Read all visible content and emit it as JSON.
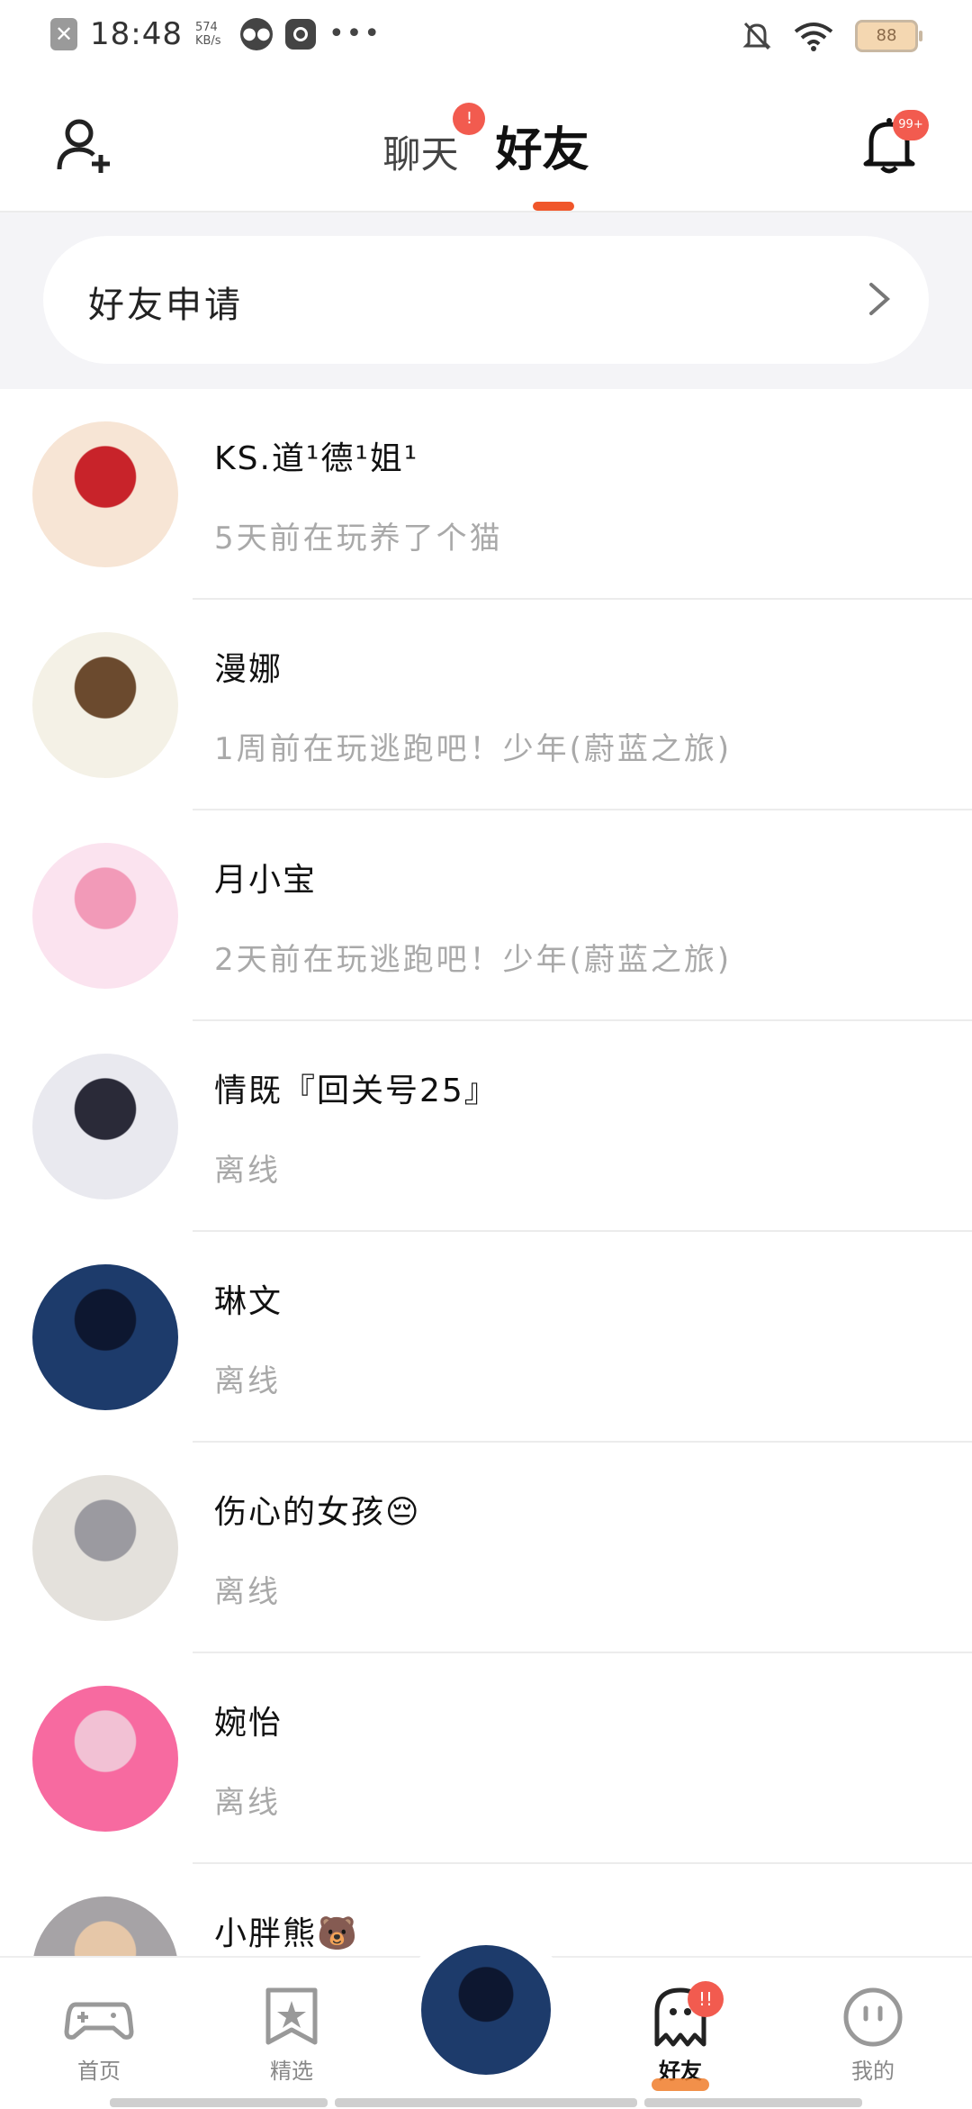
{
  "status_bar": {
    "time": "18:48",
    "net_speed": "574 KB/s",
    "battery": "88",
    "icons": [
      "close-notification-icon",
      "wechat-icon",
      "music-app-icon",
      "more-dots-icon",
      "bell-off-icon",
      "wifi-icon",
      "battery-icon"
    ]
  },
  "header": {
    "tab_chat": "聊天",
    "tab_chat_badge": "!",
    "tab_friends": "好友",
    "bell_badge": "99+",
    "icons": [
      "add-friend-icon",
      "bell-icon"
    ]
  },
  "friend_request": {
    "label": "好友申请",
    "icon": "chevron-right-icon"
  },
  "friends": [
    {
      "name": "KS.道¹德¹姐¹",
      "status": "5天前在玩养了个猫",
      "avatar_colors": [
        "#f7e5d5",
        "#c8232a"
      ]
    },
    {
      "name": "漫娜",
      "status": "1周前在玩逃跑吧！少年(蔚蓝之旅)",
      "avatar_colors": [
        "#f4f1e6",
        "#6b4a2e"
      ]
    },
    {
      "name": "月小宝",
      "status": "2天前在玩逃跑吧！少年(蔚蓝之旅)",
      "avatar_colors": [
        "#fbe3ef",
        "#f29ab8"
      ]
    },
    {
      "name": "情既『回关号25』",
      "status": "离线",
      "avatar_colors": [
        "#e9e9ef",
        "#2a2a38"
      ]
    },
    {
      "name": "琳文",
      "status": "离线",
      "avatar_colors": [
        "#1d3b6b",
        "#0d1730"
      ]
    },
    {
      "name": "伤心的女孩😔",
      "status": "离线",
      "avatar_colors": [
        "#e4e1dc",
        "#9b9aa0"
      ]
    },
    {
      "name": "婉怡",
      "status": "离线",
      "avatar_colors": [
        "#f76aa0",
        "#f2c1d4"
      ]
    },
    {
      "name": "小胖熊🐻",
      "status": "",
      "avatar_colors": [
        "#a6a3a6",
        "#e6c7a8"
      ]
    }
  ],
  "bottom_nav": {
    "home_label": "首页",
    "featured_label": "精选",
    "friends_label": "好友",
    "friends_badge": "!!",
    "mine_label": "我的",
    "icons": [
      "gamepad-icon",
      "star-bookmark-icon",
      "ghost-icon",
      "smiley-face-icon"
    ]
  },
  "colors": {
    "accent": "#f0562a",
    "badge": "#f25b4f",
    "muted_text": "#a9a9a9",
    "section_bg": "#f4f4f7"
  }
}
